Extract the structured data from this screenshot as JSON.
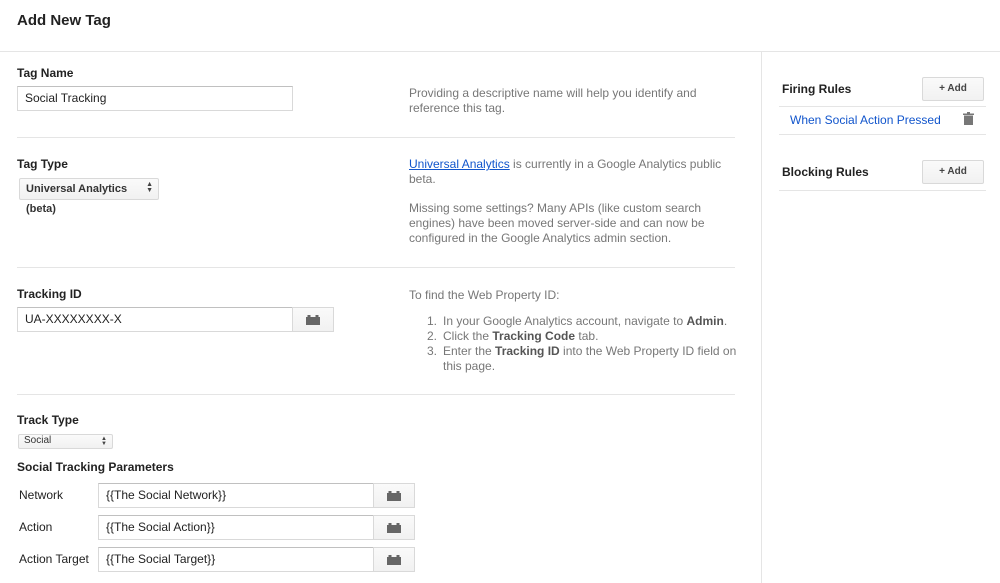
{
  "header": {
    "title": "Add New Tag"
  },
  "tag_name": {
    "label": "Tag Name",
    "value": "Social Tracking",
    "help": "Providing a descriptive name will help you identify and reference this tag."
  },
  "tag_type": {
    "label": "Tag Type",
    "selected": "Universal Analytics (beta)",
    "help_link": "Universal Analytics",
    "help_text": " is currently in a Google Analytics public beta.",
    "help2": "Missing some settings? Many APIs (like custom search engines) have been moved server-side and can now be configured in the Google Analytics admin section."
  },
  "tracking_id": {
    "label": "Tracking ID",
    "value": "UA-XXXXXXXX-X",
    "help_intro": "To find the Web Property ID:",
    "steps": [
      {
        "num": "1.",
        "a": "In your Google Analytics account, navigate to ",
        "b": "Admin",
        "c": "."
      },
      {
        "num": "2.",
        "a": "Click the ",
        "b": "Tracking Code",
        "c": " tab."
      },
      {
        "num": "3.",
        "a": "Enter the ",
        "b": "Tracking ID",
        "c": " into the Web Property ID field on this page."
      }
    ]
  },
  "track_type": {
    "label": "Track Type",
    "selected": "Social"
  },
  "social": {
    "label": "Social Tracking Parameters",
    "params": [
      {
        "label": "Network",
        "value": "{{The Social Network}}"
      },
      {
        "label": "Action",
        "value": "{{The Social Action}}"
      },
      {
        "label": "Action Target",
        "value": "{{The Social Target}}"
      }
    ]
  },
  "sidebar": {
    "firing_label": "Firing Rules",
    "add_label": "+ Add",
    "firing_rule": "When Social Action Pressed",
    "blocking_label": "Blocking Rules"
  },
  "icons": {
    "macro": "macro-brick-icon",
    "trash": "trash-icon",
    "select_arrows": "updown-arrows-icon"
  },
  "colors": {
    "link": "#1155cc",
    "help_text": "#777777",
    "divider": "#e5e5e5"
  }
}
